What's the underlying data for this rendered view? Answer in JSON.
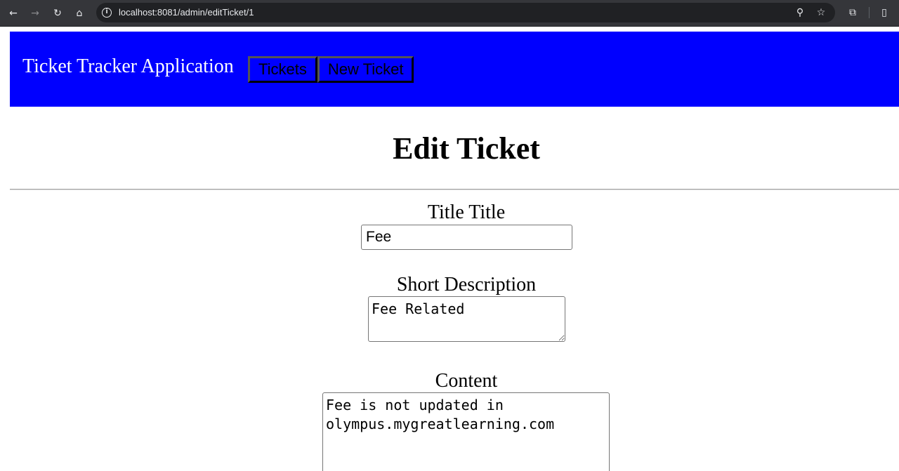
{
  "browser": {
    "url": "localhost:8081/admin/editTicket/1"
  },
  "header": {
    "app_title": "Ticket Tracker Application",
    "nav": [
      {
        "label": "Tickets"
      },
      {
        "label": "New Ticket"
      }
    ],
    "background_color": "#0000ff"
  },
  "page": {
    "title": "Edit Ticket"
  },
  "form": {
    "title_label": "Title Title",
    "title_value": "Fee",
    "short_description_label": "Short Description",
    "short_description_value": "Fee Related",
    "content_label": "Content",
    "content_value": "Fee is not updated in\nolympus.mygreatlearning.com"
  },
  "icons": {
    "back": "back-arrow-icon",
    "forward": "forward-arrow-icon",
    "reload": "reload-icon",
    "home": "home-icon",
    "info": "info-icon",
    "zoom": "zoom-icon",
    "bookmark": "star-icon",
    "extensions": "puzzle-icon",
    "side_panel": "side-panel-icon"
  }
}
